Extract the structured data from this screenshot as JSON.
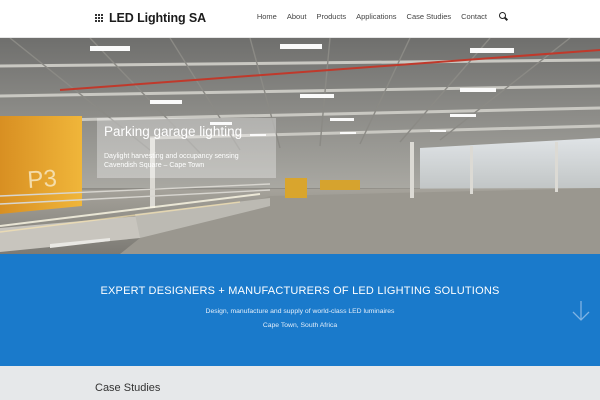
{
  "header": {
    "logo_text": "LED Lighting SA",
    "nav": [
      "Home",
      "About",
      "Products",
      "Applications",
      "Case Studies",
      "Contact"
    ]
  },
  "hero": {
    "title": "Parking garage lighting",
    "subtitle_line1": "Daylight harvesting and occupancy sensing",
    "subtitle_line2": "Cavendish Square – Cape Town",
    "wall_text": "P3"
  },
  "banner": {
    "title": "EXPERT DESIGNERS + MANUFACTURERS OF LED LIGHTING SOLUTIONS",
    "line1": "Design, manufacture and supply of world-class LED luminaires",
    "line2": "Cape Town, South Africa"
  },
  "case_studies": {
    "title": "Case Studies"
  },
  "colors": {
    "banner_blue": "#1a7acb",
    "accent_yellow": "#e8a92a",
    "strip_grey": "#e6e8ea"
  },
  "icons": {
    "search": "search-icon",
    "scroll": "arrow-down-icon"
  }
}
